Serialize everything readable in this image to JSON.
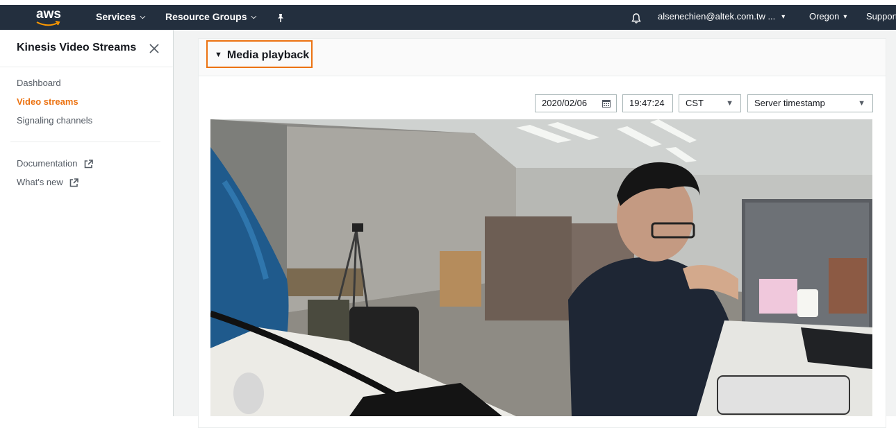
{
  "nav": {
    "logo_text": "aws",
    "services_label": "Services",
    "resource_groups_label": "Resource Groups",
    "account_label": "alsenechien@altek.com.tw ...",
    "region_label": "Oregon",
    "support_label": "Support"
  },
  "sidebar": {
    "title": "Kinesis Video Streams",
    "items": [
      {
        "label": "Dashboard",
        "active": false
      },
      {
        "label": "Video streams",
        "active": true
      },
      {
        "label": "Signaling channels",
        "active": false
      }
    ],
    "links": [
      {
        "label": "Documentation"
      },
      {
        "label": "What's new"
      }
    ]
  },
  "panel": {
    "title": "Media playback",
    "controls": {
      "date": "2020/02/06",
      "time": "19:47:24",
      "timezone": "CST",
      "timestamp_type": "Server timestamp"
    }
  },
  "colors": {
    "navbar": "#232f3e",
    "accent": "#ec7211",
    "sidebar_text": "#545b64"
  },
  "icons": [
    "aws-logo",
    "caret-down-icon",
    "pin-icon",
    "bell-icon",
    "close-icon",
    "external-link-icon",
    "calendar-icon",
    "triangle-down-icon"
  ]
}
